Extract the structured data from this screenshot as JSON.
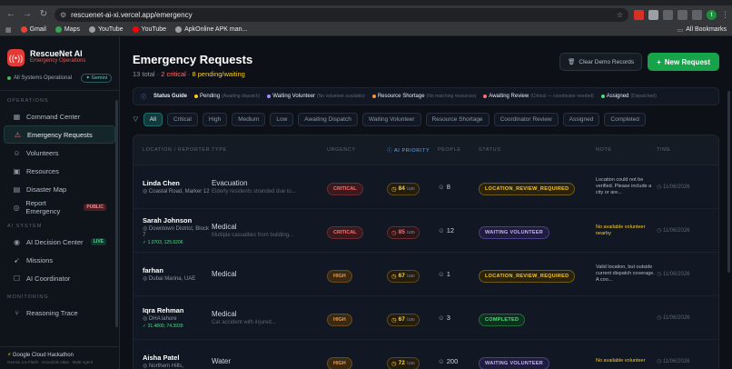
{
  "browser": {
    "url": "rescuenet-ai-xi.vercel.app/emergency",
    "bookmarks": [
      "Gmail",
      "Maps",
      "YouTube",
      "YouTube",
      "ApkOnline APK man..."
    ],
    "all_bookmarks": "All Bookmarks",
    "avatar_letter": "t"
  },
  "sidebar": {
    "title": "RescueNet AI",
    "subtitle": "Emergency Operations",
    "status": "All Systems Operational",
    "gemini": "Gemini",
    "sections": {
      "operations": "OPERATIONS",
      "ai_system": "AI SYSTEM",
      "monitoring": "MONITORING"
    },
    "items": {
      "command": "Command Center",
      "requests": "Emergency Requests",
      "volunteers": "Volunteers",
      "resources": "Resources",
      "map": "Disaster Map",
      "report": "Report Emergency",
      "public_tag": "PUBLIC",
      "decision": "AI Decision Center",
      "live_tag": "LIVE",
      "missions": "Missions",
      "coordinator": "AI Coordinator",
      "trace": "Reasoning Trace"
    },
    "footer_title": "Google Cloud Hackathon",
    "footer_sub": "Gemini 2.5 Flash · Hono(GB Atlas · Multi Agent"
  },
  "header": {
    "title": "Emergency Requests",
    "total": "13 total",
    "critical": "2 critical",
    "pending": "8 pending/waiting",
    "clear": "Clear Demo Records",
    "new": "New Request"
  },
  "guide": {
    "label": "Status Guide",
    "items": [
      {
        "name": "Pending",
        "hint": "(Awaiting dispatch)",
        "color": "#facc15"
      },
      {
        "name": "Waiting Volunteer",
        "hint": "(No volunteer available)",
        "color": "#a78bfa"
      },
      {
        "name": "Resource Shortage",
        "hint": "(No matching resources)",
        "color": "#fb923c"
      },
      {
        "name": "Awaiting Review",
        "hint": "(Critical — coordinator needed)",
        "color": "#f87171"
      },
      {
        "name": "Assigned",
        "hint": "(Dispatched)",
        "color": "#4ade80"
      }
    ]
  },
  "filters": [
    "All",
    "Critical",
    "High",
    "Medium",
    "Low",
    "Awaiting Dispatch",
    "Waiting Volunteer",
    "Resource Shortage",
    "Coordinator Review",
    "Assigned",
    "Completed"
  ],
  "columns": {
    "reporter": "LOCATION / REPORTER",
    "type": "TYPE",
    "urgency": "URGENCY",
    "priority": "AI PRIORITY",
    "people": "PEOPLE",
    "status": "STATUS",
    "note": "NOTE",
    "time": "TIME"
  },
  "rows": [
    {
      "name": "Linda Chen",
      "loc": "Coastal Road, Marker 12",
      "coord": "",
      "type": "Evacuation",
      "desc": "Elderly residents stranded due to...",
      "urgency": "CRITICAL",
      "prio": "84",
      "prio_max": "/100",
      "people": "8",
      "status": "LOCATION_REVIEW_REQUIRED",
      "note": "Location could not be verified. Please include a city or are...",
      "time": "11/06/2026"
    },
    {
      "name": "Sarah Johnson",
      "loc": "Downtown District, Block 7",
      "coord": "✓ 1.0703, 125.6206",
      "type": "Medical",
      "desc": "Multiple casualties from building...",
      "urgency": "CRITICAL",
      "prio": "85",
      "prio_max": "/100",
      "people": "12",
      "status": "WAITING VOLUNTEER",
      "note": "No available volunteer nearby",
      "time": "11/06/2026"
    },
    {
      "name": "farhan",
      "loc": "Dubai Marina, UAE",
      "coord": "",
      "type": "Medical",
      "desc": "",
      "urgency": "HIGH",
      "prio": "67",
      "prio_max": "/100",
      "people": "1",
      "status": "LOCATION_REVIEW_REQUIRED",
      "note": "Valid location, but outside current dispatch coverage. A coo...",
      "time": "11/06/2026"
    },
    {
      "name": "Iqra Rehman",
      "loc": "DHA lahore",
      "coord": "✓ 31.4800, 74.3939",
      "type": "Medical",
      "desc": "Car accident with injured...",
      "urgency": "HIGH",
      "prio": "67",
      "prio_max": "/100",
      "people": "3",
      "status": "COMPLETED",
      "note": "",
      "time": "11/06/2026"
    },
    {
      "name": "Aisha Patel",
      "loc": "Northern Hills,",
      "coord": "",
      "type": "Water",
      "desc": "",
      "urgency": "HIGH",
      "prio": "72",
      "prio_max": "/100",
      "people": "200",
      "status": "WAITING VOLUNTEER",
      "note": "No available volunteer",
      "time": "11/06/2026"
    }
  ]
}
